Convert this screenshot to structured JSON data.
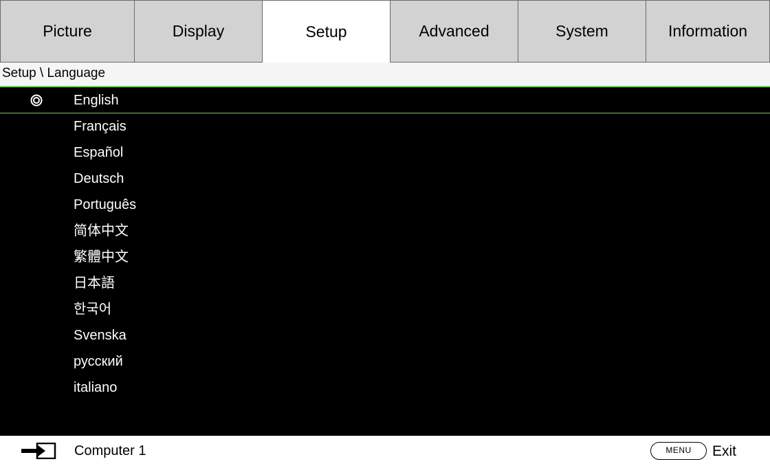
{
  "tabs": [
    {
      "label": "Picture",
      "active": false
    },
    {
      "label": "Display",
      "active": false
    },
    {
      "label": "Setup",
      "active": true
    },
    {
      "label": "Advanced",
      "active": false
    },
    {
      "label": "System",
      "active": false
    },
    {
      "label": "Information",
      "active": false
    }
  ],
  "breadcrumb": "Setup \\ Language",
  "languages": {
    "selected_index": 0,
    "items": [
      "English",
      "Français",
      "Español",
      "Deutsch",
      "Português",
      "简体中文",
      "繁體中文",
      "日本語",
      "한국어",
      "Svenska",
      "русский",
      "italiano"
    ]
  },
  "status": {
    "source_icon": "input-source-icon",
    "source_label": "Computer 1",
    "menu_key": "MENU",
    "exit_label": "Exit"
  },
  "colors": {
    "highlight_line": "#7cc85a",
    "list_background": "#000000",
    "inactive_tab": "#d2d2d2"
  }
}
